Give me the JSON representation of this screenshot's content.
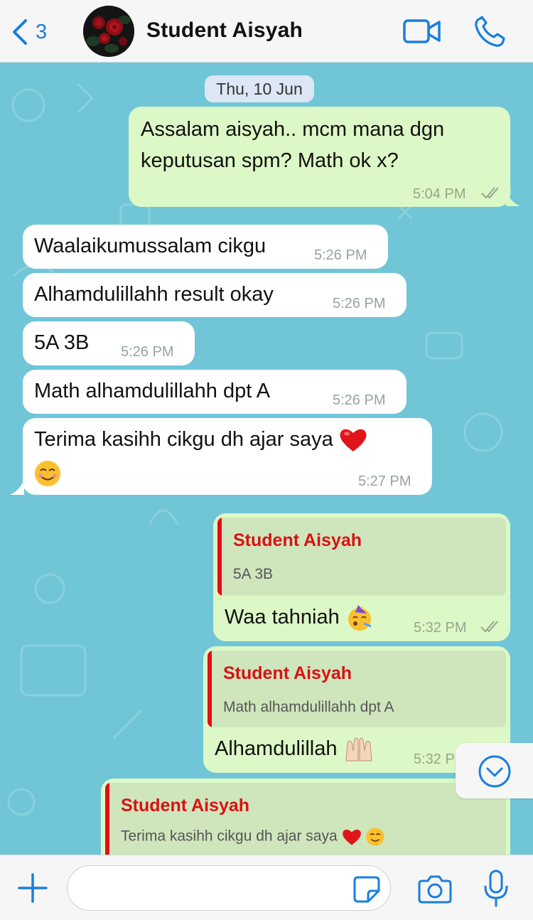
{
  "header": {
    "back_count": "3",
    "contact_name": "Student Aisyah",
    "accent": "#1a7ee0"
  },
  "chat": {
    "background": "#70c6d7",
    "date": "Thu, 10 Jun",
    "messages": [
      {
        "direction": "outgoing",
        "lines": [
          "Assalam aisyah.. mcm mana dgn",
          "keputusan spm? Math ok x?"
        ],
        "time": "5:04 PM",
        "status": "read"
      },
      {
        "direction": "incoming",
        "text": "Waalaikumussalam cikgu",
        "time": "5:26 PM"
      },
      {
        "direction": "incoming",
        "text": "Alhamdulillahh result okay",
        "time": "5:26 PM"
      },
      {
        "direction": "incoming",
        "text": "5A 3B",
        "time": "5:26 PM"
      },
      {
        "direction": "incoming",
        "text": "Math alhamdulillahh dpt A",
        "time": "5:26 PM"
      },
      {
        "direction": "incoming",
        "text": "Terima kasihh cikgu dh ajar saya",
        "emoji": [
          "red-heart",
          "smiling-face"
        ],
        "time": "5:27 PM"
      },
      {
        "direction": "outgoing",
        "quote": {
          "name": "Student Aisyah",
          "text": "5A 3B"
        },
        "text": "Waa tahniah",
        "emoji": [
          "partying-face"
        ],
        "time": "5:32 PM",
        "status": "read"
      },
      {
        "direction": "outgoing",
        "quote": {
          "name": "Student Aisyah",
          "text": "Math alhamdulillahh dpt A"
        },
        "text": "Alhamdulillah",
        "emoji": [
          "raised-hands"
        ],
        "time": "5:32 P"
      },
      {
        "direction": "outgoing",
        "quote": {
          "name": "Student Aisyah",
          "text": "Terima kasihh cikgu dh ajar saya",
          "emoji": [
            "red-heart",
            "smiling-face"
          ]
        }
      }
    ]
  },
  "colors": {
    "outgoing_bubble": "#dcf8c6",
    "incoming_bubble": "#ffffff",
    "quote_name": "#d91212",
    "quote_bar": "#e00f14"
  },
  "input": {
    "placeholder": "",
    "value": ""
  },
  "icons": [
    "chevron-left-icon",
    "video-icon",
    "phone-icon",
    "chevron-down-icon",
    "plus-icon",
    "sticker-icon",
    "camera-icon",
    "microphone-icon"
  ]
}
